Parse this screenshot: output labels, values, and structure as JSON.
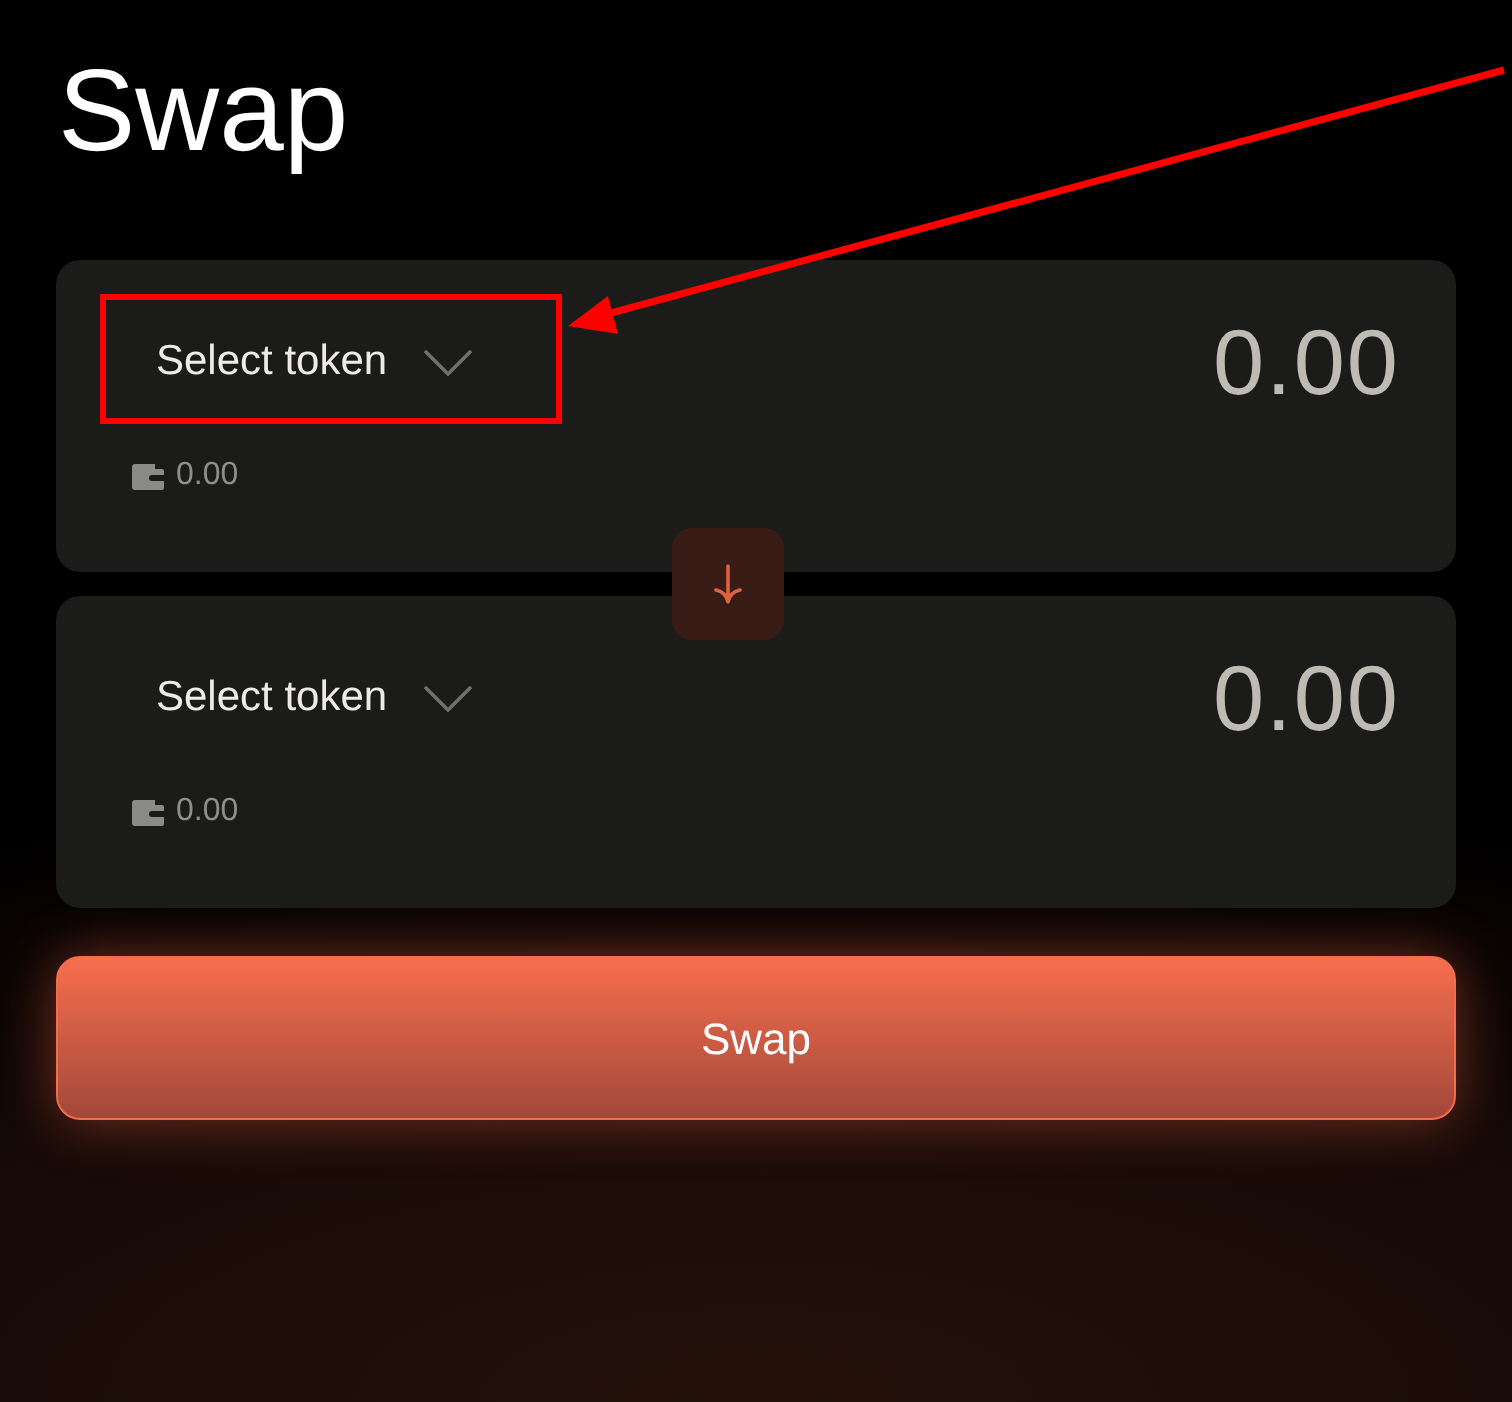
{
  "title": "Swap",
  "panels": [
    {
      "token_button": "Select token",
      "highlighted": true,
      "amount": "0.00",
      "balance": "0.00"
    },
    {
      "token_button": "Select token",
      "highlighted": false,
      "amount": "0.00",
      "balance": "0.00"
    }
  ],
  "swap_button": "Swap"
}
